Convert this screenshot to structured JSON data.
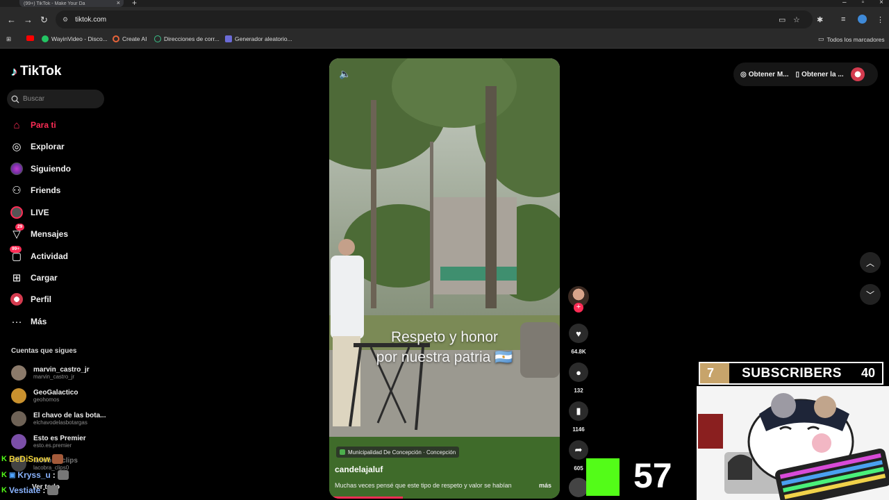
{
  "browser": {
    "tab_title": "(99+) TikTok - Make Your Da",
    "url": "tiktok.com",
    "bookmarks": [
      "WayinVideo - Disco...",
      "Create AI",
      "Direcciones de corr...",
      "Generador aleatorio..."
    ],
    "all_bookmarks": "Todos los marcadores"
  },
  "sidebar": {
    "logo": "TikTok",
    "search_placeholder": "Buscar",
    "nav": [
      {
        "label": "Para ti"
      },
      {
        "label": "Explorar"
      },
      {
        "label": "Siguiendo"
      },
      {
        "label": "Friends"
      },
      {
        "label": "LIVE"
      },
      {
        "label": "Mensajes",
        "badge": "29"
      },
      {
        "label": "Actividad",
        "badge": "99+"
      },
      {
        "label": "Cargar"
      },
      {
        "label": "Perfil"
      },
      {
        "label": "Más"
      }
    ],
    "following_title": "Cuentas que sigues",
    "following": [
      {
        "name": "marvin_castro_jr",
        "handle": "marvin_castro_jr"
      },
      {
        "name": "GeoGalactico",
        "handle": "geohomos"
      },
      {
        "name": "El chavo de las bota...",
        "handle": "elchavodelasbotargas"
      },
      {
        "name": "Esto es Premier",
        "handle": "esto.es.premier"
      },
      {
        "name": "lacobra_clips",
        "handle": "lacobra_clips0"
      },
      {
        "name": "Ver todo",
        "handle": ""
      }
    ]
  },
  "chat": [
    {
      "user": "BeDiSnow",
      "color": "#f0d33a"
    },
    {
      "user": "Kryss_u",
      "color": "#8ab4ff"
    },
    {
      "user": "Vestiate",
      "color": "#8ab4ff"
    }
  ],
  "video": {
    "caption_line1": "Respeto y honor",
    "caption_line2": "por nuestra patria 🇦🇷",
    "location": "Municipalidad De Concepción · Concepción",
    "username": "candelajaluf",
    "description": "Muchas veces pensé que este tipo de respeto y valor se habían",
    "more": "más",
    "progress": 0.32
  },
  "actions": {
    "likes": "64.8K",
    "comments": "132",
    "saves": "1146",
    "shares": "605"
  },
  "topbar": {
    "coins": "Obtener M...",
    "app": "Obtener la ..."
  },
  "overlay": {
    "kick_count": "57",
    "subs_current": "7",
    "subs_label": "SUBSCRIBERS",
    "subs_goal": "40"
  },
  "colors": {
    "accent": "#fe2c55",
    "kick": "#53fc18"
  }
}
